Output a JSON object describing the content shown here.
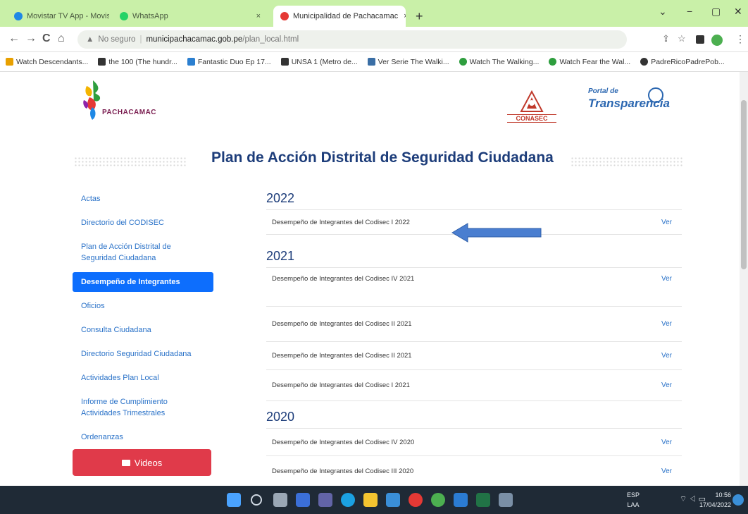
{
  "browser": {
    "tabs": [
      {
        "label": "Movistar TV App - Movistar TV | ",
        "active": false
      },
      {
        "label": "WhatsApp",
        "active": false
      },
      {
        "label": "Municipalidad de Pachacamac",
        "active": true
      }
    ],
    "tab_close": "×",
    "new_tab": "+",
    "window_controls": [
      "⌄",
      "−",
      "▢",
      "✕"
    ],
    "nav": {
      "back": "←",
      "forward": "→",
      "reload": "C",
      "home": "⌂"
    },
    "address": {
      "security": "No seguro",
      "domain": "municipachacamac.gob.pe",
      "path": "/plan_local.html"
    },
    "bookmarks": [
      {
        "label": "Watch Descendants...",
        "color": "#e8a000"
      },
      {
        "label": "the 100 (The hundr...",
        "color": "#333333"
      },
      {
        "label": "Fantastic Duo Ep 17...",
        "color": "#2b7fd0"
      },
      {
        "label": "UNSA 1 (Metro de...",
        "color": "#333333"
      },
      {
        "label": "Ver Serie The Walki...",
        "color": "#3a6ea5"
      },
      {
        "label": "Watch The Walking...",
        "color": "#2e9e3e"
      },
      {
        "label": "Watch Fear the Wal...",
        "color": "#2e9e3e"
      },
      {
        "label": "PadreRicoPadrePob...",
        "color": "#333333"
      }
    ]
  },
  "header": {
    "logo_text": "PACHACAMAC",
    "conasec": "CONASEC",
    "portal_top": "Portal de",
    "portal_main": "Transparencia"
  },
  "page_title": "Plan de Acción Distrital de Seguridad Ciudadana",
  "sidebar": {
    "items": [
      {
        "label": "Actas"
      },
      {
        "label": "Directorio del CODISEC"
      },
      {
        "label": "Plan de Acción Distrital de Seguridad Ciudadana"
      },
      {
        "label": "Desempeño de Integrantes",
        "active": true
      },
      {
        "label": "Oficios"
      },
      {
        "label": "Consulta Ciudadana"
      },
      {
        "label": "Directorio Seguridad Ciudadana"
      },
      {
        "label": "Actividades Plan Local"
      },
      {
        "label": "Informe de Cumplimiento Actividades Trimestrales"
      },
      {
        "label": "Ordenanzas"
      }
    ],
    "videos_button": "Videos"
  },
  "sections": [
    {
      "year": "2022",
      "rows": [
        {
          "label": "Desempeño de Integrantes del Codisec I 2022",
          "link": "Ver"
        }
      ]
    },
    {
      "year": "2021",
      "rows": [
        {
          "label": "Desempeño de Integrantes del Codisec IV 2021",
          "link": "Ver"
        },
        {
          "label": "Desempeño de Integrantes del Codisec II 2021",
          "link": "Ver"
        },
        {
          "label": "Desempeño de Integrantes del Codisec II 2021",
          "link": "Ver"
        },
        {
          "label": "Desempeño de Integrantes del Codisec I 2021",
          "link": "Ver"
        }
      ]
    },
    {
      "year": "2020",
      "rows": [
        {
          "label": "Desempeño de Integrantes del Codisec IV 2020",
          "link": "Ver"
        },
        {
          "label": "Desempeño de Integrantes del Codisec III 2020",
          "link": "Ver"
        }
      ]
    }
  ],
  "taskbar": {
    "lang": "ESP",
    "lang_sub": "LAA",
    "time": "10:56",
    "date": "17/04/2022"
  }
}
